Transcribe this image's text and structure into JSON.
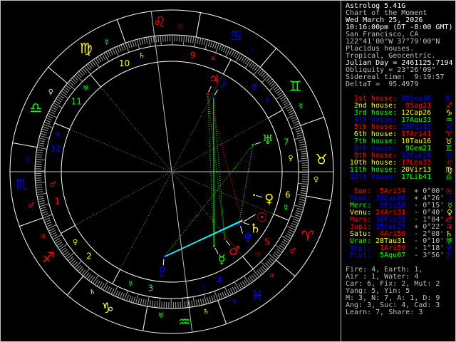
{
  "info": {
    "lines": [
      {
        "text": "Astrolog 5.41G",
        "bright": true
      },
      {
        "text": "Chart of the Moment",
        "bright": false
      },
      {
        "text": "Wed March 25, 2026",
        "bright": true
      },
      {
        "text": "10:16:00pm (DT -8:00 GMT)",
        "bright": true
      },
      {
        "text": "San Francisco, CA",
        "bright": false
      },
      {
        "text": "122°41'00\"W 37°79'00\"N",
        "bright": false
      },
      {
        "text": "Placidus houses.",
        "bright": false
      },
      {
        "text": "Tropical, Geocentric.",
        "bright": false
      },
      {
        "text": "Julian Day = 2461125.7194",
        "bright": true
      },
      {
        "text": "Obliquity = 23°26'09\"",
        "bright": false
      },
      {
        "text": "Sidereal time:  9:19:57",
        "bright": false
      },
      {
        "text": "DeltaT =  95.4979",
        "bright": false
      }
    ]
  },
  "colors": {
    "fire": "#ff0000",
    "earth": "#ffff00",
    "air": "#00ff00",
    "water": "#0000ff",
    "text": "#c0c0c0",
    "aspect_sextile": "#00ffff",
    "axis": "#c0c0c0"
  },
  "signs": [
    {
      "abbr": "Ari",
      "glyph": "♈",
      "color": "#ff0000"
    },
    {
      "abbr": "Tau",
      "glyph": "♉",
      "color": "#ffff00"
    },
    {
      "abbr": "Gem",
      "glyph": "♊",
      "color": "#00ff00"
    },
    {
      "abbr": "Can",
      "glyph": "♋",
      "color": "#0000ff"
    },
    {
      "abbr": "Leo",
      "glyph": "♌",
      "color": "#ff0000"
    },
    {
      "abbr": "Vir",
      "glyph": "♍",
      "color": "#ffff00"
    },
    {
      "abbr": "Lib",
      "glyph": "♎",
      "color": "#00ff00"
    },
    {
      "abbr": "Sco",
      "glyph": "♏",
      "color": "#0000ff"
    },
    {
      "abbr": "Sag",
      "glyph": "♐",
      "color": "#ff0000"
    },
    {
      "abbr": "Cap",
      "glyph": "♑",
      "color": "#ffff00"
    },
    {
      "abbr": "Aqu",
      "glyph": "♒",
      "color": "#00ff00"
    },
    {
      "abbr": "Pis",
      "glyph": "♓",
      "color": "#0000ff"
    }
  ],
  "sign_rulers": [
    [
      "Mars"
    ],
    [
      "Venu"
    ],
    [
      "Merc"
    ],
    [
      "Moon"
    ],
    [
      "Sun"
    ],
    [
      "Merc"
    ],
    [
      "Venu"
    ],
    [
      "Plut",
      "Mars"
    ],
    [
      "Jupi"
    ],
    [
      "Satu"
    ],
    [
      "Uran",
      "Satu"
    ],
    [
      "Nept",
      "Jupi"
    ]
  ],
  "houses": [
    {
      "number": "1",
      "label": "1st house:",
      "pos": "10Sco16",
      "color": "#ff0000",
      "pos_color": "#0000ff",
      "sign_glyph": "♏",
      "ruler": "Mars"
    },
    {
      "number": "2",
      "label": "2nd house:",
      "pos": " 9Sag21",
      "color": "#ffff00",
      "pos_color": "#ff0000",
      "sign_glyph": "♐",
      "ruler": "Venu"
    },
    {
      "number": "3",
      "label": "3rd house:",
      "pos": "12Cap26",
      "color": "#00ff00",
      "pos_color": "#ffff00",
      "sign_glyph": "♑",
      "ruler": "Merc"
    },
    {
      "number": "4",
      "label": "4th house:",
      "pos": "17Aqu33",
      "color": "#0000ff",
      "pos_color": "#00ff00",
      "sign_glyph": "♒",
      "ruler": "Moon"
    },
    {
      "number": "5",
      "label": "5th house:",
      "pos": "20Pis13",
      "color": "#ff0000",
      "pos_color": "#0000ff",
      "sign_glyph": "♓",
      "ruler": "Sun"
    },
    {
      "number": "6",
      "label": "6th house:",
      "pos": "17Ari41",
      "color": "#ffff00",
      "pos_color": "#ff0000",
      "sign_glyph": "♈",
      "ruler": "Merc"
    },
    {
      "number": "7",
      "label": "7th house:",
      "pos": "10Tau16",
      "color": "#00ff00",
      "pos_color": "#ffff00",
      "sign_glyph": "♉",
      "ruler": "Venu"
    },
    {
      "number": "8",
      "label": "8th house:",
      "pos": " 9Gem21",
      "color": "#0000ff",
      "pos_color": "#00ff00",
      "sign_glyph": "♊",
      "ruler": "Plut"
    },
    {
      "number": "9",
      "label": "9th house:",
      "pos": "12Can26",
      "color": "#ff0000",
      "pos_color": "#0000ff",
      "sign_glyph": "♋",
      "ruler": "Jupi"
    },
    {
      "number": "10",
      "label": "10th house:",
      "pos": "17Leo33",
      "color": "#ffff00",
      "pos_color": "#ff0000",
      "sign_glyph": "♌",
      "ruler": "Satu"
    },
    {
      "number": "11",
      "label": "11th house:",
      "pos": "20Vir13",
      "color": "#00ff00",
      "pos_color": "#ffff00",
      "sign_glyph": "♍",
      "ruler": "Uran"
    },
    {
      "number": "12",
      "label": "12th house:",
      "pos": "17Lib41",
      "color": "#0000ff",
      "pos_color": "#00ff00",
      "sign_glyph": "♎",
      "ruler": "Nept"
    }
  ],
  "planets": [
    {
      "id": "Sun",
      "label": "Sun:",
      "pos": " 5Ari34",
      "lat": "+ 0°00'",
      "glyph": "☉",
      "color": "#ff0000",
      "pos_color": "#ff0000"
    },
    {
      "id": "Moon",
      "label": "Moon:",
      "pos": "11Can00",
      "lat": "+ 4°26'",
      "glyph": "☽",
      "color": "#0000ff",
      "pos_color": "#0000ff"
    },
    {
      "id": "Merc",
      "label": "Merc:",
      "pos": " 9Pis50",
      "lat": "- 0°15'",
      "glyph": "☿",
      "color": "#00ff00",
      "pos_color": "#0000ff"
    },
    {
      "id": "Venu",
      "label": "Venu:",
      "pos": "24Ari31",
      "lat": "- 0°40'",
      "glyph": "♀",
      "color": "#ffff00",
      "pos_color": "#ff0000"
    },
    {
      "id": "Mars",
      "label": "Mars:",
      "pos": "18Pis35",
      "lat": "- 1°04'",
      "glyph": "♂",
      "color": "#ff0000",
      "pos_color": "#0000ff"
    },
    {
      "id": "Jupi",
      "label": "Jupi:",
      "pos": "15Can27",
      "lat": "+ 0°22'",
      "glyph": "♃",
      "color": "#ff0000",
      "pos_color": "#0000ff"
    },
    {
      "id": "Satu",
      "label": "Satu:",
      "pos": " 4Ari50",
      "lat": "- 2°08'",
      "glyph": "♄",
      "color": "#ffff00",
      "pos_color": "#ff0000"
    },
    {
      "id": "Uran",
      "label": "Uran:",
      "pos": "28Tau31",
      "lat": "- 0°10'",
      "glyph": "♅",
      "color": "#00ff00",
      "pos_color": "#ffff00"
    },
    {
      "id": "Nept",
      "label": "Nept:",
      "pos": " 1Ari59",
      "lat": "- 1°18'",
      "glyph": "♆",
      "color": "#0000ff",
      "pos_color": "#ff0000"
    },
    {
      "id": "Plut",
      "label": "Plut:",
      "pos": " 5Aqu07",
      "lat": "- 3°56'",
      "glyph": "♇",
      "color": "#0000ff",
      "pos_color": "#00ff00"
    }
  ],
  "aspects": [
    {
      "from": "Moon",
      "to": "Merc",
      "color": "#00ff00",
      "style": "solid"
    },
    {
      "from": "Moon",
      "to": "Mars",
      "color": "#00ff00",
      "style": "dotted"
    },
    {
      "from": "Jupi",
      "to": "Merc",
      "color": "#00ff00",
      "style": "dotted"
    },
    {
      "from": "Jupi",
      "to": "Mars",
      "color": "#00ff00",
      "style": "dotted"
    },
    {
      "from": "Jupi",
      "to": "Sun",
      "color": "#ff0000",
      "style": "dotted"
    },
    {
      "from": "Plut",
      "to": "Sun",
      "color": "#00ffff",
      "style": "solid"
    },
    {
      "from": "Plut",
      "to": "Satu",
      "color": "#00ffff",
      "style": "solid"
    },
    {
      "from": "Uran",
      "to": "Nept",
      "color": "#00ffff",
      "style": "dotted"
    },
    {
      "from": "Uran",
      "to": "Plut",
      "color": "#00ff00",
      "style": "dotted"
    }
  ],
  "stats": [
    "Fire: 4, Earth: 1,",
    "Air : 1, Water: 4",
    "Car: 6, Fix: 2, Mut: 2",
    "Yang: 5, Yin: 5",
    "M: 3, N: 7, A: 1, D: 9",
    "Ang: 3, Suc: 4, Cad: 3",
    "Learn: 7, Share: 3"
  ]
}
